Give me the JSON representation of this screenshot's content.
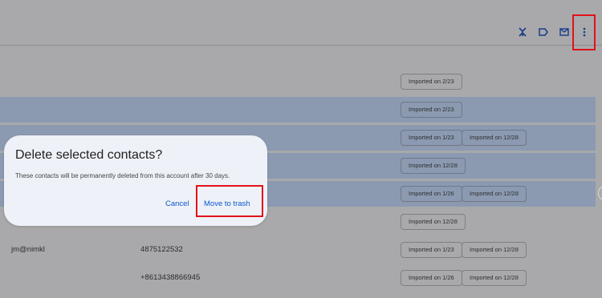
{
  "toolbar": {
    "icons": [
      "merge-icon",
      "label-icon",
      "email-icon",
      "more-vert-icon"
    ],
    "color": "#1a3a8a"
  },
  "rows": [
    {
      "selected": false,
      "email": "",
      "phone": "",
      "chips": [
        "Imported on 2/23"
      ]
    },
    {
      "selected": true,
      "email": "",
      "phone": "",
      "chips": [
        "Imported on 2/23"
      ]
    },
    {
      "selected": true,
      "email": "",
      "phone": "",
      "chips": [
        "Imported on 1/23",
        "Imported on 12/28"
      ]
    },
    {
      "selected": true,
      "email": "",
      "phone": "",
      "chips": [
        "Imported on 12/28"
      ]
    },
    {
      "selected": true,
      "email": "",
      "phone": "",
      "chips": [
        "Imported on 1/26",
        "Imported on 12/28"
      ]
    },
    {
      "selected": false,
      "email": "",
      "phone": "",
      "chips": [
        "Imported on 12/28"
      ]
    },
    {
      "selected": false,
      "email": "jm@nimkl",
      "phone": "4875122532",
      "chips": [
        "Imported on 1/23",
        "Imported on 12/28"
      ]
    },
    {
      "selected": false,
      "email": "",
      "phone": "+8613438866945",
      "chips": [
        "Imported on 1/26",
        "Imported on 12/28"
      ]
    }
  ],
  "dialog": {
    "title": "Delete selected contacts?",
    "body": "These contacts will be permanently deleted from this account after 30 days.",
    "cancel_label": "Cancel",
    "confirm_label": "Move to trash"
  },
  "colors": {
    "scrim": "#a9a9ab",
    "selected_row": "#8b9ab1",
    "dialog_bg": "#eef1f7",
    "accent": "#0b57d0",
    "highlight": "#e0121a"
  }
}
